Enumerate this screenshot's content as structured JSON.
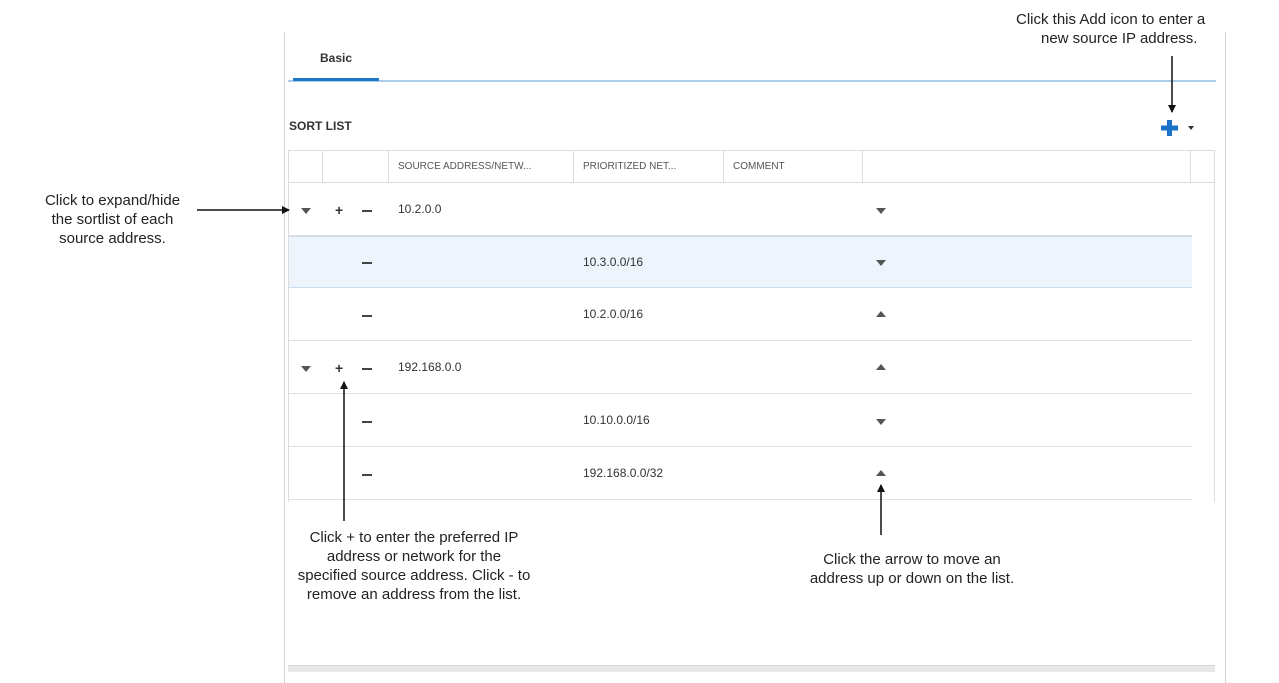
{
  "tabs": [
    {
      "label": "Basic",
      "active": true
    }
  ],
  "section_title": "SORT LIST",
  "add_button": {
    "icon": "plus-icon",
    "dropdown_icon": "caret-down-icon",
    "color": "#1a73c9"
  },
  "columns": [
    "",
    "",
    "SOURCE ADDRESS/NETW...",
    "PRIORITIZED NET...",
    "COMMENT",
    ""
  ],
  "rows": [
    {
      "type": "source",
      "expanded": true,
      "source": "10.2.0.0",
      "network": "",
      "move": "down"
    },
    {
      "type": "child",
      "selected": true,
      "source": "",
      "network": "10.3.0.0/16",
      "move": "down"
    },
    {
      "type": "child",
      "source": "",
      "network": "10.2.0.0/16",
      "move": "up"
    },
    {
      "type": "source",
      "expanded": true,
      "source": "192.168.0.0",
      "network": "",
      "move": "up"
    },
    {
      "type": "child",
      "source": "",
      "network": "10.10.0.0/16",
      "move": "down"
    },
    {
      "type": "child",
      "source": "",
      "network": "192.168.0.0/32",
      "move": "up"
    }
  ],
  "annotations": {
    "add_icon": [
      "Click this Add icon to enter a",
      "new source IP address."
    ],
    "expand": [
      "Click to expand/hide",
      "the sortlist of each",
      "source address."
    ],
    "plus_minus": [
      "Click + to enter the preferred IP",
      "address or network for the",
      "specified source address. Click - to",
      "remove an address from the list."
    ],
    "move_arrow": [
      "Click the arrow to move an",
      "address up or down on the list."
    ]
  },
  "colors": {
    "accent": "#1f77c8",
    "tab_line": "#a9cdea",
    "selected_row": "#eef4fb"
  }
}
